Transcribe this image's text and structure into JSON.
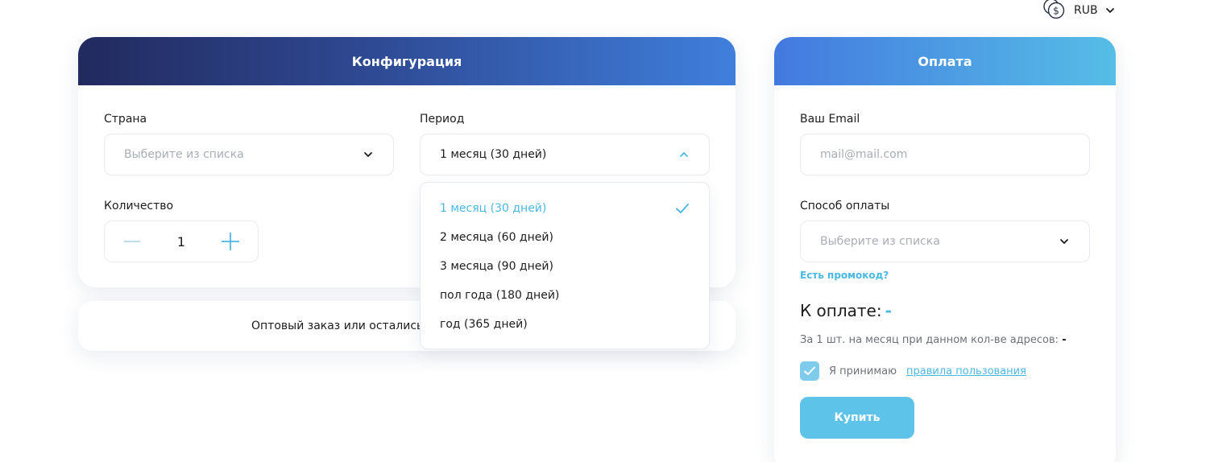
{
  "currency": {
    "label": "RUB",
    "icon": "coins-icon"
  },
  "config": {
    "title": "Конфигурация",
    "country": {
      "label": "Страна",
      "placeholder": "Выберите из списка"
    },
    "period": {
      "label": "Период",
      "value": "1 месяц (30 дней)"
    },
    "quantity": {
      "label": "Количество",
      "value": "1"
    },
    "period_options": [
      {
        "label": "1 месяц (30 дней)",
        "selected": true
      },
      {
        "label": "2 месяца (60 дней)",
        "selected": false
      },
      {
        "label": "3 месяца (90 дней)",
        "selected": false
      },
      {
        "label": "пол года (180 дней)",
        "selected": false
      },
      {
        "label": "год (365 дней)",
        "selected": false
      }
    ]
  },
  "wholesale": {
    "text": "Оптовый заказ или остались вопросы?"
  },
  "payment": {
    "title": "Оплата",
    "email": {
      "label": "Ваш Email",
      "placeholder": "mail@mail.com"
    },
    "method": {
      "label": "Способ оплаты",
      "placeholder": "Выберите из списка"
    },
    "promo_link": "Есть промокод?",
    "total_label": "К оплате:",
    "total_value": "-",
    "per_unit_label": "За 1 шт. на месяц при данном кол-ве адресов:",
    "per_unit_value": "-",
    "agree_text": "Я принимаю",
    "agree_link": "правила пользования",
    "agree_checked": true,
    "buy_label": "Купить"
  },
  "colors": {
    "accent": "#4bb7e3",
    "button": "#5ec3e8",
    "header_dark": "#222a5e",
    "header_light": "#3f7fdc"
  }
}
